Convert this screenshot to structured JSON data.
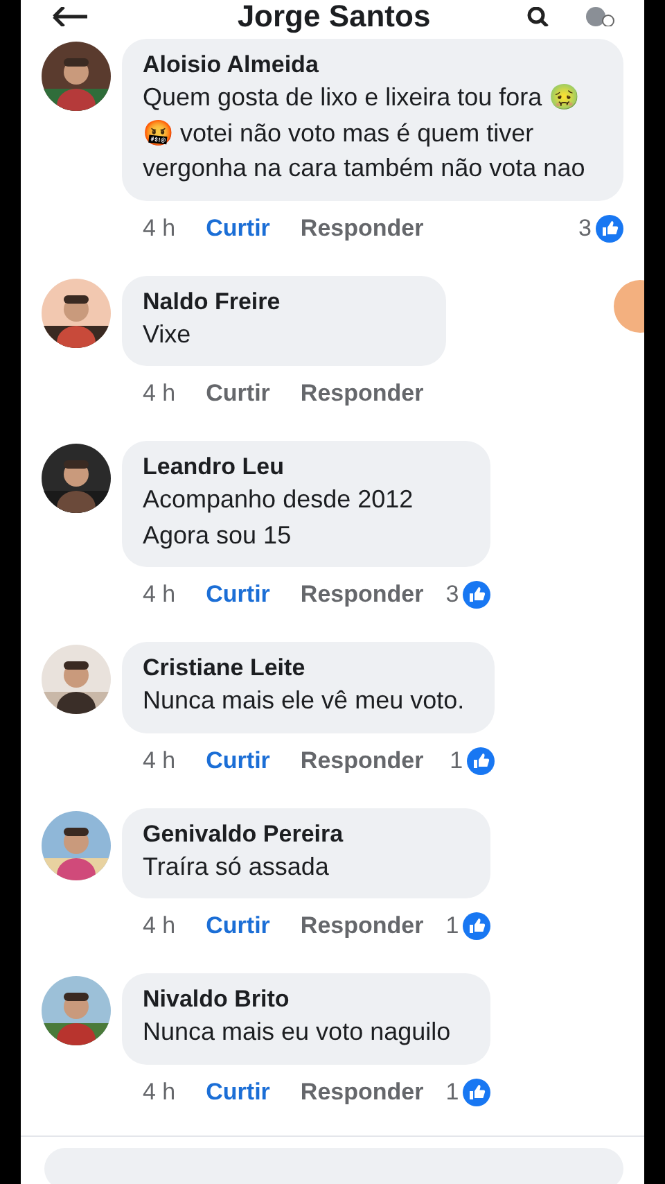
{
  "header": {
    "title": "Jorge Santos"
  },
  "comments": [
    {
      "author": "Aloisio Almeida",
      "text": "Quem gosta de lixo e lixeira tou fora 🤢🤬 votei não voto mas é quem tiver vergonha na cara também não vota nao",
      "time": "4 h",
      "like_label": "Curtir",
      "liked": true,
      "reply_label": "Responder",
      "reactions": "3"
    },
    {
      "author": "Naldo Freire",
      "text": "Vixe",
      "time": "4 h",
      "like_label": "Curtir",
      "liked": false,
      "reply_label": "Responder"
    },
    {
      "author": "Leandro Leu",
      "text": "Acompanho desde 2012\nAgora sou 15",
      "time": "4 h",
      "like_label": "Curtir",
      "liked": true,
      "reply_label": "Responder",
      "reactions": "3"
    },
    {
      "author": "Cristiane Leite",
      "text": "Nunca mais ele vê meu voto.",
      "time": "4 h",
      "like_label": "Curtir",
      "liked": true,
      "reply_label": "Responder",
      "reactions": "1"
    },
    {
      "author": "Genivaldo Pereira",
      "text": "Traíra só assada",
      "time": "4 h",
      "like_label": "Curtir",
      "liked": true,
      "reply_label": "Responder",
      "reactions": "1"
    },
    {
      "author": "Nivaldo Brito",
      "text": "Nunca mais eu voto naguilo",
      "time": "4 h",
      "like_label": "Curtir",
      "liked": true,
      "reply_label": "Responder",
      "reactions": "1"
    }
  ]
}
